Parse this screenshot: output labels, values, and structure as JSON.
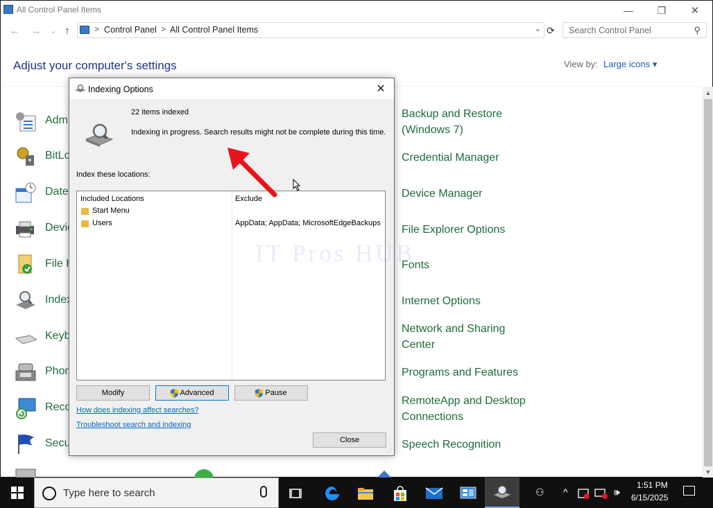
{
  "window": {
    "title": "All Control Panel Items",
    "caption": {
      "minimize": "—",
      "maximize": "❐",
      "close": "✕"
    }
  },
  "nav": {
    "back": "←",
    "forward": "→",
    "recent": "⌄",
    "up": "↑",
    "breadcrumb": [
      "Control Panel",
      "All Control Panel Items"
    ],
    "separator": ">",
    "dropdown": "⌄",
    "refresh": "⟳",
    "search_placeholder": "Search Control Panel",
    "search_icon": "⚲"
  },
  "header": {
    "title": "Adjust your computer's settings",
    "view_by_label": "View by:",
    "view_by_value": "Large icons ▾"
  },
  "left_items": [
    {
      "label": "Adm",
      "icon": "admin-tools-icon"
    },
    {
      "label": "BitLo",
      "icon": "bitlocker-icon"
    },
    {
      "label": "Date",
      "icon": "date-time-icon"
    },
    {
      "label": "Devic",
      "icon": "devices-printers-icon"
    },
    {
      "label": "File H",
      "icon": "file-history-icon"
    },
    {
      "label": "Index",
      "icon": "indexing-options-icon"
    },
    {
      "label": "Keyb",
      "icon": "keyboard-icon"
    },
    {
      "label": "Phon",
      "icon": "phone-modem-icon"
    },
    {
      "label": "Reco",
      "icon": "recovery-icon"
    },
    {
      "label": "Secu",
      "icon": "security-maintenance-icon"
    }
  ],
  "right_items": [
    {
      "line1": "Backup and Restore",
      "line2": "(Windows 7)"
    },
    {
      "line1": "Credential Manager"
    },
    {
      "line1": "Device Manager"
    },
    {
      "line1": "File Explorer Options"
    },
    {
      "line1": "Fonts"
    },
    {
      "line1": "Internet Options"
    },
    {
      "line1": "Network and Sharing",
      "line2": "Center"
    },
    {
      "line1": "Programs and Features"
    },
    {
      "line1": "RemoteApp and Desktop",
      "line2": "Connections"
    },
    {
      "line1": "Speech Recognition"
    }
  ],
  "dialog": {
    "title": "Indexing Options",
    "close": "✕",
    "items_indexed": "22 items indexed",
    "status": "Indexing in progress. Search results might not be complete during this time.",
    "index_label": "Index these locations:",
    "columns": {
      "included": "Included Locations",
      "exclude": "Exclude"
    },
    "locations": [
      {
        "name": "Start Menu",
        "exclude": ""
      },
      {
        "name": "Users",
        "exclude": "AppData; AppData; MicrosoftEdgeBackups"
      }
    ],
    "buttons": {
      "modify": "Modify",
      "advanced": "Advanced",
      "pause": "Pause",
      "close": "Close"
    },
    "links": {
      "how": "How does indexing affect searches?",
      "troubleshoot": "Troubleshoot search and indexing"
    }
  },
  "watermark": "IT Pros HUB",
  "taskbar": {
    "search_placeholder": "Type here to search",
    "time": "1:51 PM",
    "date": "6/15/2025",
    "tray": {
      "people": "⚇",
      "chevron": "^",
      "volume": "🕪"
    }
  },
  "colors": {
    "link_green": "#1e6b3b",
    "heading_blue": "#1e3287",
    "annotation_arrow": "#e8141b",
    "taskbar": "#101010"
  }
}
